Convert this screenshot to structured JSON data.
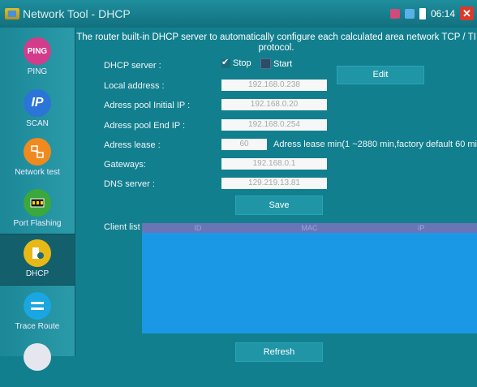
{
  "window": {
    "title": "Network Tool - DHCP",
    "time": "06:14"
  },
  "sidebar": {
    "items": [
      {
        "label": "PING",
        "icon_text": "PING",
        "icon_color": "#d23c8b"
      },
      {
        "label": "SCAN",
        "icon_text": "IP",
        "icon_color": "#2b74d8"
      },
      {
        "label": "Network test",
        "icon_text": "",
        "icon_color": "#f08a1e"
      },
      {
        "label": "Port Flashing",
        "icon_text": "",
        "icon_color": "#3aa83a"
      },
      {
        "label": "DHCP",
        "icon_text": "",
        "icon_color": "#e8b916"
      },
      {
        "label": "Trace Route",
        "icon_text": "",
        "icon_color": "#1aa6e0"
      }
    ]
  },
  "description": {
    "line1": "The router built-in DHCP server to automatically configure each calculated area network TCP / TI",
    "line2": "protocol."
  },
  "dhcp_server": {
    "label": "DHCP server :",
    "stop": "Stop",
    "start": "Start"
  },
  "edit_label": "Edit",
  "fields": {
    "local_address": {
      "label": "Local address :",
      "value": "192.168.0.238"
    },
    "pool_initial": {
      "label": "Adress pool Initial IP :",
      "value": "192.168.0.20"
    },
    "pool_end": {
      "label": "Adress pool End IP :",
      "value": "192.168.0.254"
    },
    "lease": {
      "label": "Adress lease :",
      "value": "60",
      "hint": "Adress lease min(1 ~2880 min,factory default 60 min)"
    },
    "gateways": {
      "label": "Gateways:",
      "value": "192.168.0.1"
    },
    "dns": {
      "label": "DNS server :",
      "value": "129.219.13.81"
    }
  },
  "save_label": "Save",
  "client_list": {
    "label": "Client list :",
    "columns": [
      "ID",
      "MAC",
      "IP"
    ]
  },
  "refresh_label": "Refresh"
}
